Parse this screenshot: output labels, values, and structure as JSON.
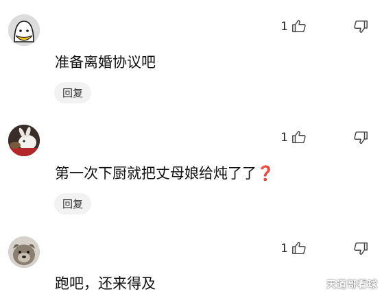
{
  "comments": [
    {
      "username": "",
      "text": "准备离婚协议吧",
      "likes": "1",
      "reply_label": "回复",
      "avatar": "ghost-smile-avatar",
      "emoji": ""
    },
    {
      "username": "",
      "text": "第一次下厨就把丈母娘给炖了了",
      "likes": "1",
      "reply_label": "回复",
      "avatar": "rabbit-photo-avatar",
      "emoji": "❓"
    },
    {
      "username": "",
      "text": "跑吧，还来得及",
      "likes": "1",
      "reply_label": "",
      "avatar": "dog-photo-avatar",
      "emoji": ""
    }
  ],
  "watermark": "天道哥看球",
  "colors": {
    "reply_bg": "#f2f2f2",
    "question_mark": "#d8302f",
    "icon_stroke": "#444444"
  }
}
